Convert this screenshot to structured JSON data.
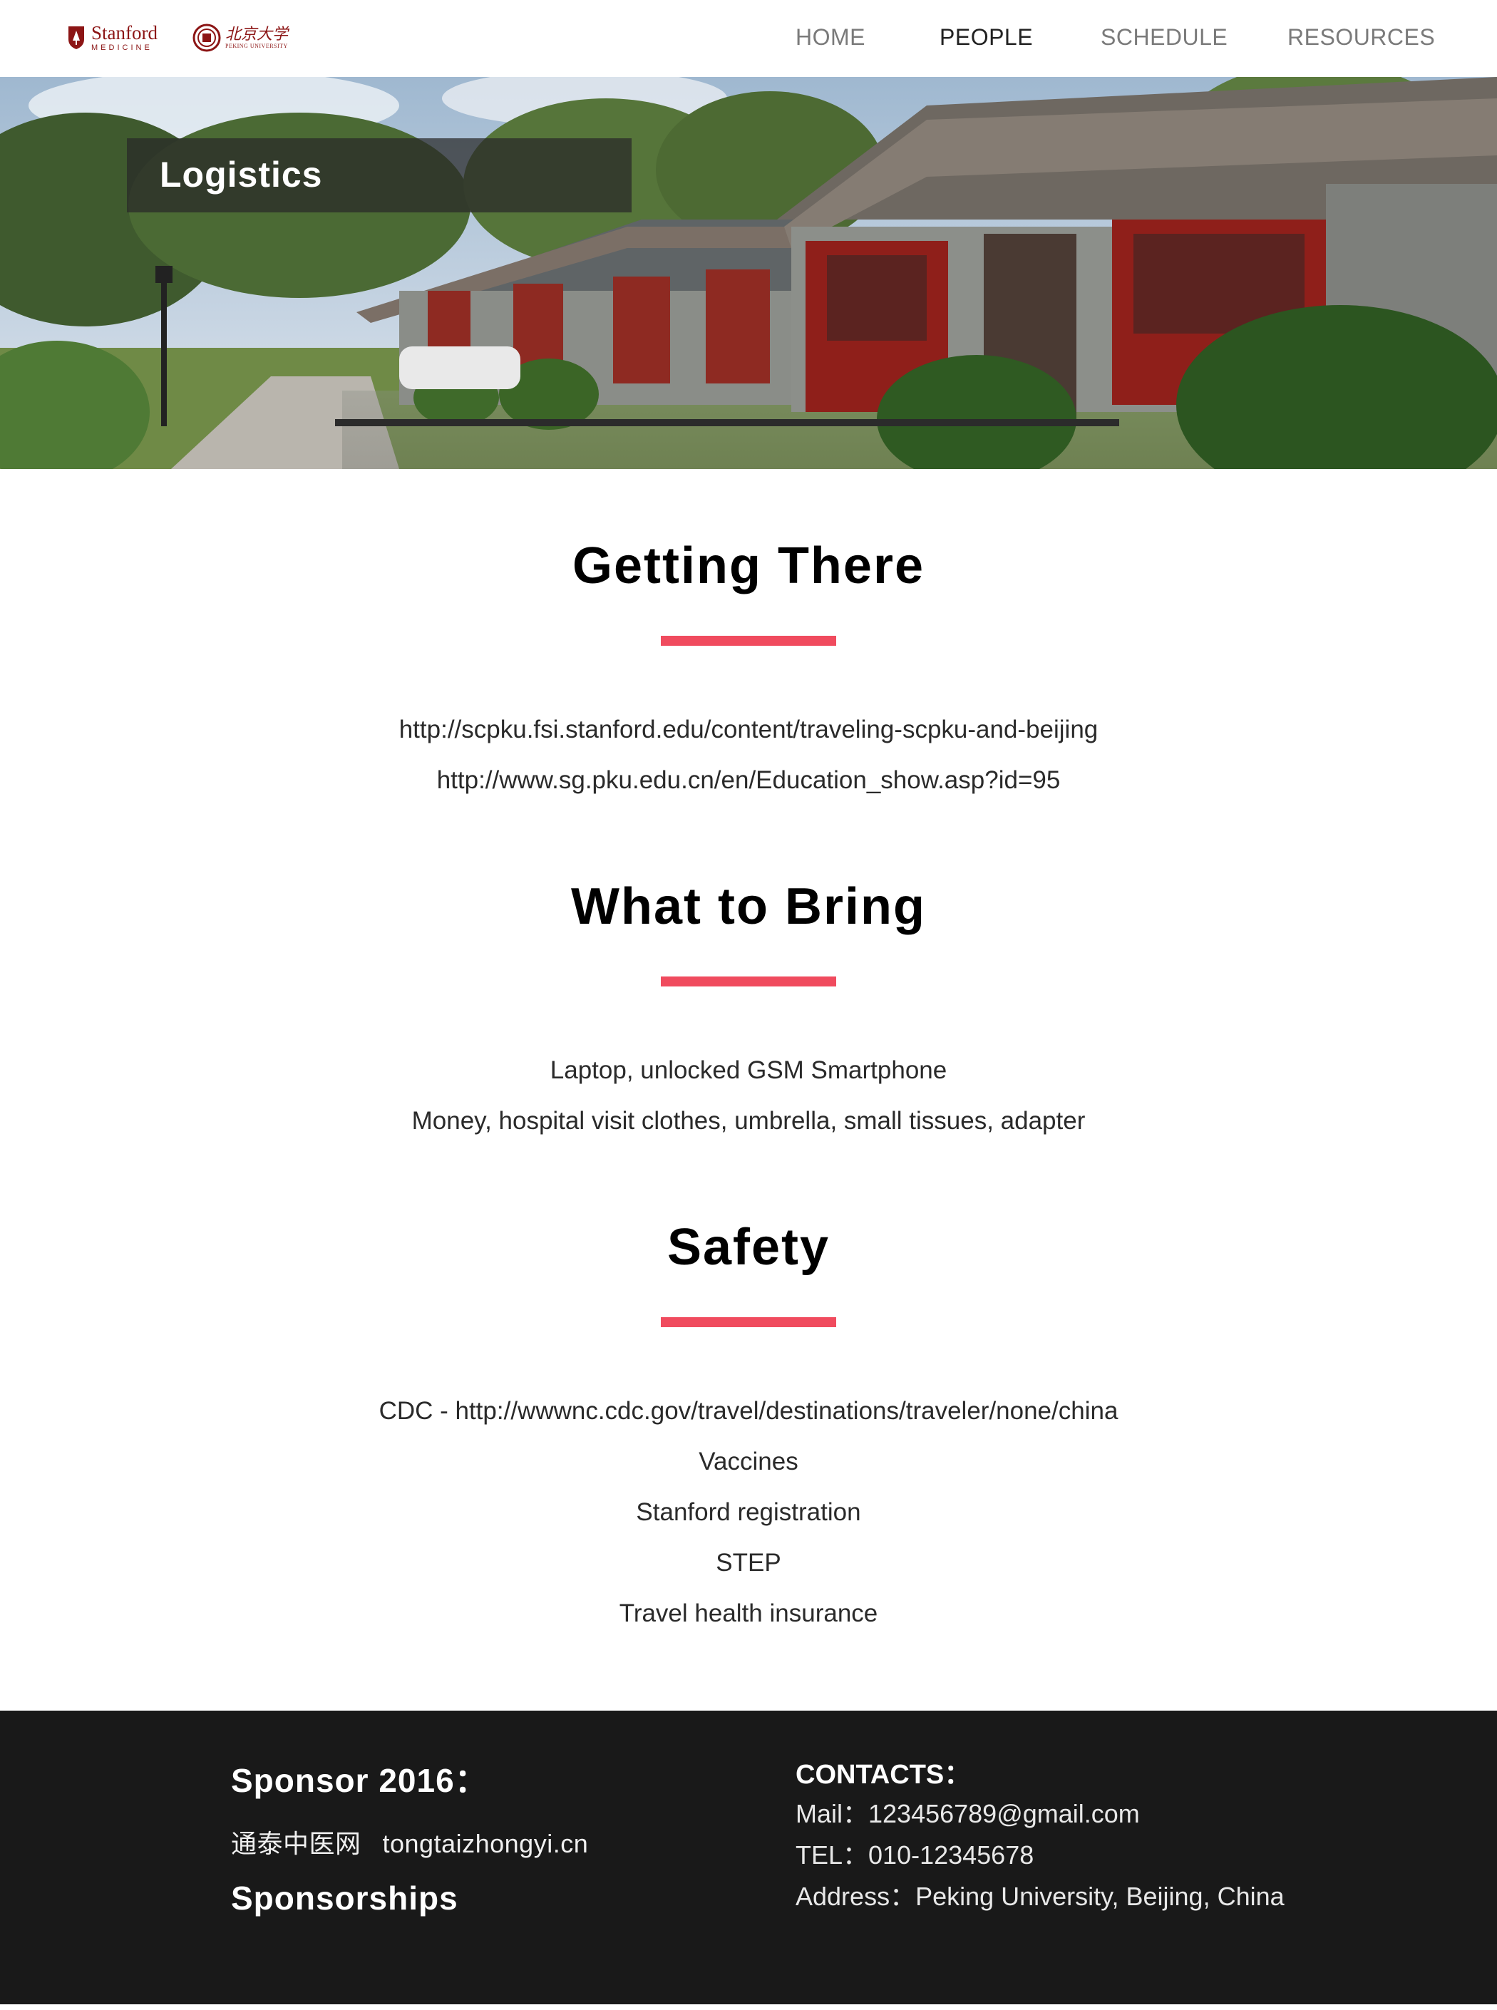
{
  "header": {
    "stanford": {
      "name": "Stanford",
      "sub": "MEDICINE"
    },
    "pku": {
      "name": "北京大学",
      "sub": "PEKING UNIVERSITY"
    },
    "nav": [
      {
        "label": "HOME",
        "active": false
      },
      {
        "label": "PEOPLE",
        "active": true
      },
      {
        "label": "SCHEDULE",
        "active": false
      },
      {
        "label": "RESOURCES",
        "active": false
      }
    ]
  },
  "hero": {
    "title": "Logistics"
  },
  "sections": [
    {
      "title": "Getting There",
      "lines": [
        "http://scpku.fsi.stanford.edu/content/traveling-scpku-and-beijing",
        "http://www.sg.pku.edu.cn/en/Education_show.asp?id=95"
      ]
    },
    {
      "title": "What to Bring",
      "lines": [
        "Laptop, unlocked GSM Smartphone",
        "Money, hospital visit clothes, umbrella, small tissues, adapter"
      ]
    },
    {
      "title": "Safety",
      "lines": [
        "CDC - http://wwwnc.cdc.gov/travel/destinations/traveler/none/china",
        "Vaccines",
        "Stanford registration",
        "STEP",
        "Travel health insurance"
      ]
    }
  ],
  "footer": {
    "sponsor_title": "Sponsor 2016：",
    "sponsor_name": "通泰中医网",
    "sponsor_url": "tongtaizhongyi.cn",
    "sponsorships": "Sponsorships",
    "contacts_title": "CONTACTS：",
    "mail": "Mail：123456789@gmail.com",
    "tel": "TEL：010-12345678",
    "address": "Address：Peking University, Beijing, China"
  },
  "colors": {
    "accent": "#f04b5e",
    "stanford_red": "#8c1515",
    "footer_bg": "#191919"
  }
}
